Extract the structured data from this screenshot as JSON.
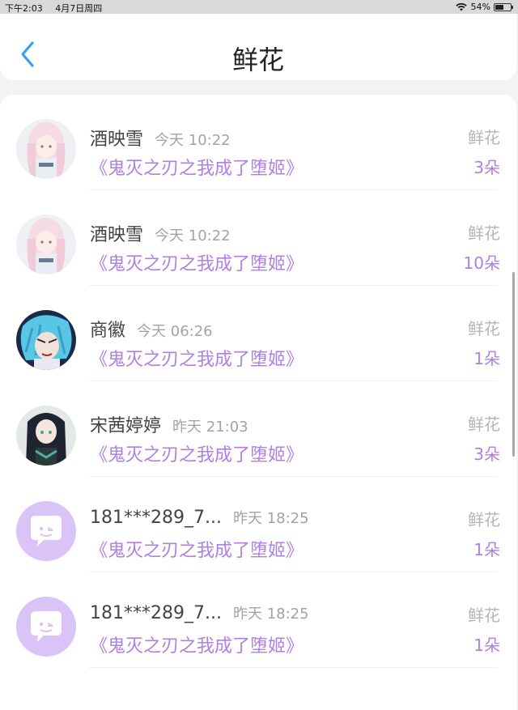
{
  "status_bar": {
    "time": "下午2:03",
    "date": "4月7日周四",
    "battery": "54%",
    "battery_level": 0.54
  },
  "header": {
    "title": "鲜花",
    "back_icon": "chevron-left-icon"
  },
  "colors": {
    "accent": "#b07fe6",
    "back": "#3a9ff0",
    "default_avatar_bg": "#d9c3f7"
  },
  "items": [
    {
      "name": "酒映雪",
      "time": "今天 10:22",
      "book": "《鬼灭之刃之我成了堕姬》",
      "type": "鲜花",
      "count": "3朵",
      "avatar": "anime-girl-white-hair"
    },
    {
      "name": "酒映雪",
      "time": "今天 10:22",
      "book": "《鬼灭之刃之我成了堕姬》",
      "type": "鲜花",
      "count": "10朵",
      "avatar": "anime-girl-white-hair"
    },
    {
      "name": "商徽",
      "time": "今天 06:26",
      "book": "《鬼灭之刃之我成了堕姬》",
      "type": "鲜花",
      "count": "1朵",
      "avatar": "anime-boy-blue-hair"
    },
    {
      "name": "宋茜婷婷",
      "time": "昨天 21:03",
      "book": "《鬼灭之刃之我成了堕姬》",
      "type": "鲜花",
      "count": "3朵",
      "avatar": "anime-girl-dark-hair"
    },
    {
      "name": "181***289_7...",
      "time": "昨天 18:25",
      "book": "《鬼灭之刃之我成了堕姬》",
      "type": "鲜花",
      "count": "1朵",
      "avatar": "default-chat-avatar"
    },
    {
      "name": "181***289_7...",
      "time": "昨天 18:25",
      "book": "《鬼灭之刃之我成了堕姬》",
      "type": "鲜花",
      "count": "1朵",
      "avatar": "default-chat-avatar"
    }
  ]
}
